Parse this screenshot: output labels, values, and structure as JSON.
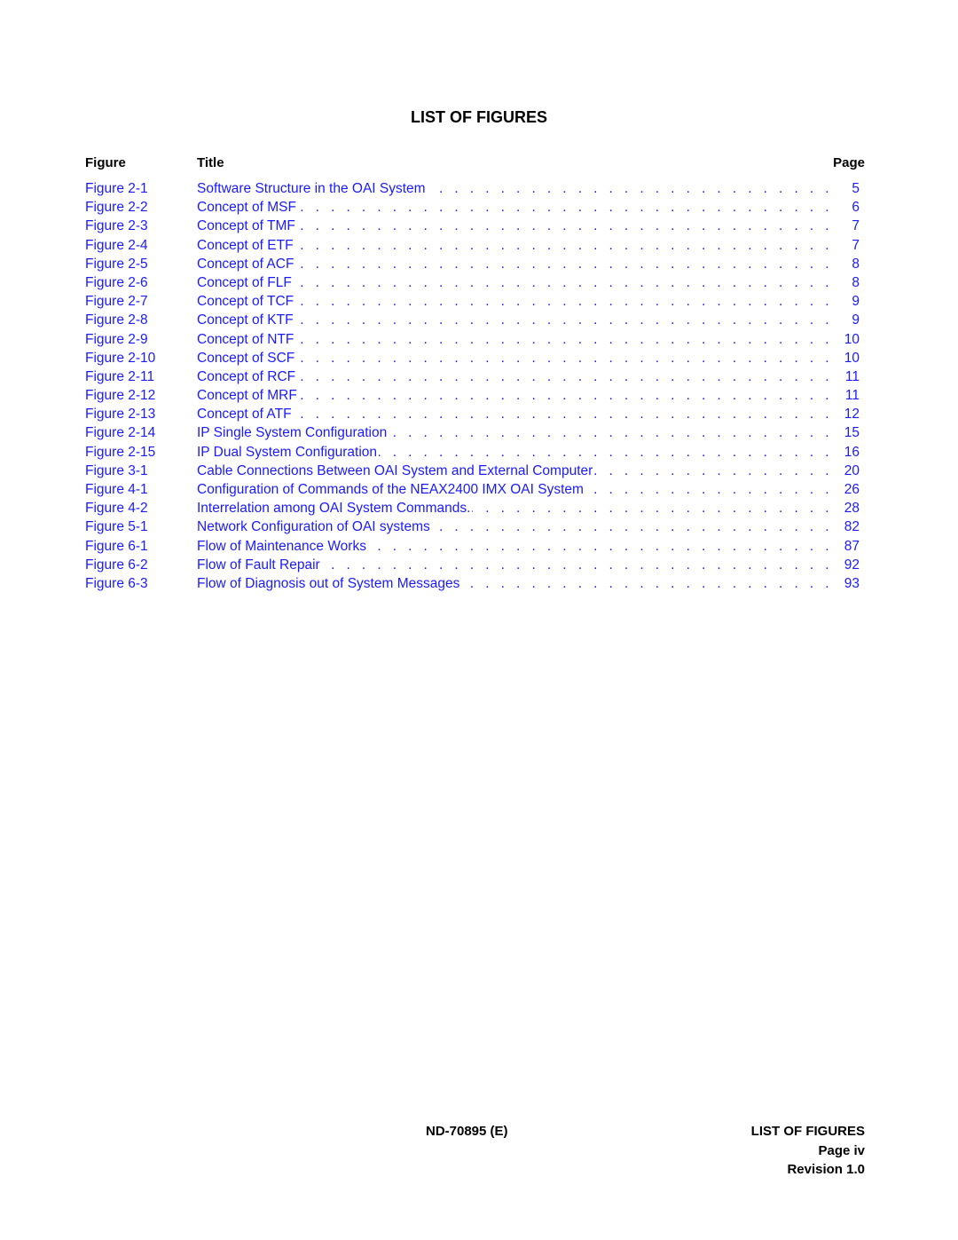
{
  "title": "LIST OF FIGURES",
  "headers": {
    "figure": "Figure",
    "title": "Title",
    "page": "Page"
  },
  "link_color": "#1a1aff",
  "figures": [
    {
      "number": "Figure 2-1",
      "title": "Software Structure in the OAI System",
      "page": "5"
    },
    {
      "number": "Figure 2-2",
      "title": "Concept of MSF",
      "page": "6"
    },
    {
      "number": "Figure 2-3",
      "title": "Concept of TMF",
      "page": "7"
    },
    {
      "number": "Figure 2-4",
      "title": "Concept of ETF",
      "page": "7"
    },
    {
      "number": "Figure 2-5",
      "title": "Concept of ACF",
      "page": "8"
    },
    {
      "number": "Figure 2-6",
      "title": "Concept of FLF",
      "page": "8"
    },
    {
      "number": "Figure 2-7",
      "title": "Concept of TCF",
      "page": "9"
    },
    {
      "number": "Figure 2-8",
      "title": "Concept of KTF",
      "page": "9"
    },
    {
      "number": "Figure 2-9",
      "title": "Concept of NTF",
      "page": "10"
    },
    {
      "number": "Figure 2-10",
      "title": "Concept of SCF",
      "page": "10"
    },
    {
      "number": "Figure 2-11",
      "title": "Concept of RCF",
      "page": "11"
    },
    {
      "number": "Figure 2-12",
      "title": "Concept of MRF",
      "page": "11"
    },
    {
      "number": "Figure 2-13",
      "title": "Concept of ATF",
      "page": "12"
    },
    {
      "number": "Figure 2-14",
      "title": "IP Single System Configuration",
      "page": "15"
    },
    {
      "number": "Figure 2-15",
      "title": "IP Dual System Configuration",
      "page": "16"
    },
    {
      "number": "Figure 3-1",
      "title": "Cable Connections Between OAI System and External Computer",
      "page": "20"
    },
    {
      "number": "Figure 4-1",
      "title": "Configuration of Commands of the NEAX2400 IMX OAI System",
      "page": "26"
    },
    {
      "number": "Figure 4-2",
      "title": "Interrelation among OAI System Commands.",
      "page": "28"
    },
    {
      "number": "Figure 5-1",
      "title": "Network Configuration of OAI systems",
      "page": "82"
    },
    {
      "number": "Figure 6-1",
      "title": "Flow of Maintenance Works",
      "page": "87"
    },
    {
      "number": "Figure 6-2",
      "title": "Flow of Fault Repair",
      "page": "92"
    },
    {
      "number": "Figure 6-3",
      "title": "Flow of Diagnosis out of System Messages",
      "page": "93"
    }
  ],
  "footer": {
    "document_id": "ND-70895 (E)",
    "section": "LIST OF FIGURES",
    "page": "Page iv",
    "revision": "Revision 1.0"
  }
}
